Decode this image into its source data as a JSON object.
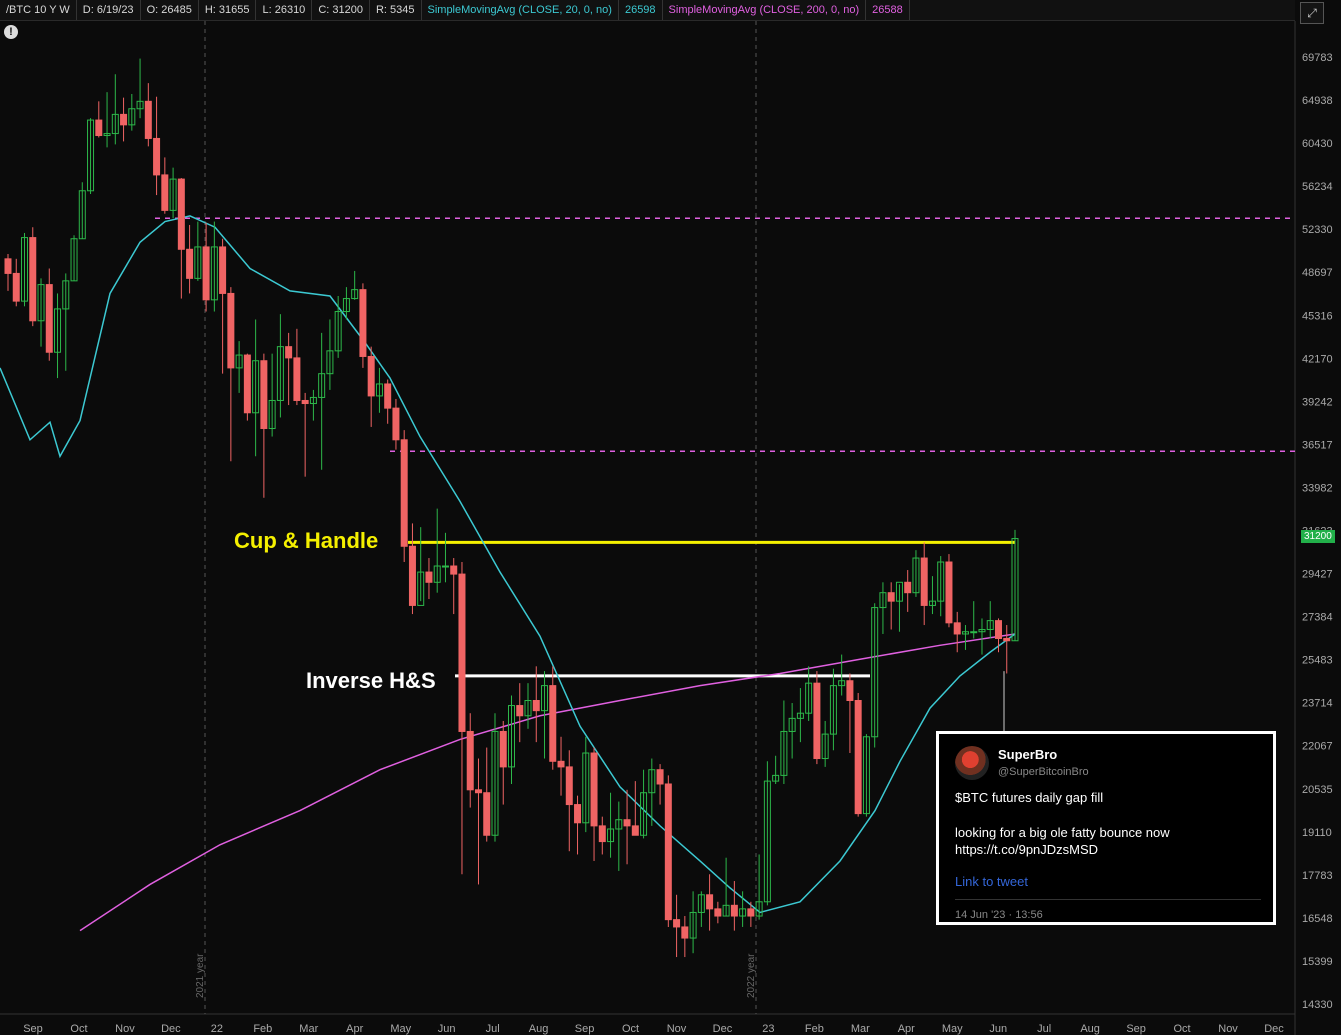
{
  "header": {
    "symbol": "/BTC 10 Y W",
    "date": "D: 6/19/23",
    "open": "O: 26485",
    "high": "H: 31655",
    "low": "L: 26310",
    "close": "C: 31200",
    "range": "R: 5345",
    "sma20_label": "SimpleMovingAvg (CLOSE, 20, 0, no)",
    "sma20_value": "26598",
    "sma200_label": "SimpleMovingAvg (CLOSE, 200, 0, no)",
    "sma200_value": "26588"
  },
  "colors": {
    "up": "#2db84a",
    "down": "#f06464",
    "sma20": "#3cc9d2",
    "sma200": "#e060e0",
    "grid_dash": "#555"
  },
  "icons": {
    "info": "info-icon",
    "expand": "expand-icon"
  },
  "info_glyph": "!",
  "annotations": {
    "cup_handle": "Cup & Handle",
    "inverse_hs": "Inverse H&S"
  },
  "price_badge": "31200",
  "tweet": {
    "name": "SuperBro",
    "handle": "@SuperBitcoinBro",
    "line1": "$BTC futures daily gap fill",
    "line2": "looking for a big ole fatty bounce now https://t.co/9pnJDzsMSD",
    "link": "Link to tweet",
    "date": "14 Jun '23 · 13:56"
  },
  "chart_data": {
    "type": "candlestick",
    "y_ticks": [
      69783,
      64938,
      60430,
      56234,
      52330,
      48697,
      45316,
      42170,
      39242,
      36517,
      33982,
      31623,
      29427,
      27384,
      25483,
      23714,
      22067,
      20535,
      19110,
      17783,
      16548,
      15399,
      14330
    ],
    "x_labels": [
      "Sep",
      "Oct",
      "Nov",
      "Dec",
      "22",
      "Feb",
      "Mar",
      "Apr",
      "May",
      "Jun",
      "Jul",
      "Aug",
      "Sep",
      "Oct",
      "Nov",
      "Dec",
      "23",
      "Feb",
      "Mar",
      "Apr",
      "May",
      "Jun",
      "Jul",
      "Aug",
      "Sep",
      "Oct",
      "Nov",
      "Dec"
    ],
    "year_labels": [
      "2021 year",
      "2022 year"
    ],
    "horizontal_levels": [
      {
        "price": 53300,
        "style": "dashed",
        "color": "#e060e0"
      },
      {
        "price": 36100,
        "style": "dashed",
        "color": "#e060e0"
      },
      {
        "price": 31000,
        "style": "solid",
        "color": "#f5f000"
      },
      {
        "price": 24800,
        "style": "solid",
        "color": "#ffffff"
      }
    ],
    "candles": [
      [
        49800,
        50200,
        47200,
        48600
      ],
      [
        48600,
        49800,
        46000,
        46400
      ],
      [
        46400,
        52000,
        46000,
        51600
      ],
      [
        51600,
        52500,
        44500,
        44900
      ],
      [
        44900,
        48200,
        43000,
        47700
      ],
      [
        47700,
        49000,
        42000,
        42600
      ],
      [
        42600,
        47000,
        40800,
        45800
      ],
      [
        45800,
        48600,
        41300,
        48000
      ],
      [
        48000,
        51800,
        48000,
        51500
      ],
      [
        51500,
        56600,
        51500,
        55800
      ],
      [
        55800,
        63000,
        55500,
        62800
      ],
      [
        62800,
        64800,
        61000,
        61200
      ],
      [
        61200,
        65800,
        60000,
        61400
      ],
      [
        61400,
        67800,
        60300,
        63400
      ],
      [
        63400,
        65200,
        60600,
        62300
      ],
      [
        62300,
        65600,
        61700,
        64000
      ],
      [
        64000,
        69600,
        63000,
        64800
      ],
      [
        64800,
        66800,
        60100,
        60900
      ],
      [
        60900,
        65300,
        55400,
        57300
      ],
      [
        57300,
        59000,
        53700,
        54000
      ],
      [
        54000,
        58000,
        53300,
        56900
      ],
      [
        56900,
        57000,
        46600,
        50600
      ],
      [
        50600,
        52700,
        47000,
        48200
      ],
      [
        48200,
        53000,
        48000,
        50800
      ],
      [
        50800,
        52900,
        45600,
        46500
      ],
      [
        46500,
        53000,
        45600,
        50800
      ],
      [
        50800,
        51500,
        41100,
        47000
      ],
      [
        47000,
        47500,
        35500,
        41500
      ],
      [
        41500,
        43400,
        39800,
        42400
      ],
      [
        42400,
        42500,
        38000,
        38500
      ],
      [
        38500,
        45000,
        35800,
        42000
      ],
      [
        42000,
        42500,
        33400,
        37500
      ],
      [
        37500,
        42500,
        37000,
        39300
      ],
      [
        39300,
        45400,
        38200,
        43000
      ],
      [
        43000,
        44000,
        39000,
        42200
      ],
      [
        42200,
        44300,
        39000,
        39300
      ],
      [
        39300,
        39800,
        34600,
        39100
      ],
      [
        39100,
        40000,
        38000,
        39500
      ],
      [
        39500,
        44000,
        35000,
        41100
      ],
      [
        41100,
        45000,
        40000,
        42700
      ],
      [
        42700,
        46800,
        42200,
        45600
      ],
      [
        45600,
        47500,
        45000,
        46600
      ],
      [
        46600,
        48800,
        46500,
        47300
      ],
      [
        47300,
        47800,
        41500,
        42300
      ],
      [
        42300,
        43000,
        37600,
        39600
      ],
      [
        39600,
        41500,
        38500,
        40400
      ],
      [
        40400,
        40700,
        37800,
        38800
      ],
      [
        38800,
        39400,
        36200,
        36800
      ],
      [
        36800,
        37400,
        30000,
        30800
      ],
      [
        30800,
        32000,
        27500,
        27900
      ],
      [
        27900,
        31800,
        28100,
        29500
      ],
      [
        29500,
        30200,
        28200,
        29000
      ],
      [
        29000,
        32800,
        28500,
        29800
      ],
      [
        29800,
        31500,
        29000,
        29800
      ],
      [
        29800,
        30200,
        27500,
        29400
      ],
      [
        29400,
        30000,
        17800,
        22600
      ],
      [
        22600,
        23300,
        19900,
        20500
      ],
      [
        20500,
        21600,
        17500,
        20400
      ],
      [
        20400,
        22000,
        18800,
        19000
      ],
      [
        19000,
        23300,
        18800,
        22600
      ],
      [
        22600,
        23000,
        20000,
        21300
      ],
      [
        21300,
        24000,
        20700,
        23600
      ],
      [
        23600,
        24500,
        22200,
        23200
      ],
      [
        23200,
        24500,
        22700,
        23800
      ],
      [
        23800,
        25200,
        22200,
        23400
      ],
      [
        23400,
        25000,
        21600,
        24400
      ],
      [
        24400,
        25200,
        21200,
        21500
      ],
      [
        21500,
        22400,
        20300,
        21300
      ],
      [
        21300,
        21900,
        18500,
        20000
      ],
      [
        20000,
        20300,
        18400,
        19400
      ],
      [
        19400,
        22400,
        19100,
        21800
      ],
      [
        21800,
        22000,
        18200,
        19300
      ],
      [
        19300,
        19600,
        18400,
        18800
      ],
      [
        18800,
        20400,
        18300,
        19200
      ],
      [
        19200,
        20100,
        17900,
        19500
      ],
      [
        19500,
        20500,
        18100,
        19300
      ],
      [
        19300,
        20800,
        19000,
        19000
      ],
      [
        19000,
        21200,
        18900,
        20400
      ],
      [
        20400,
        21600,
        19300,
        21200
      ],
      [
        21200,
        21400,
        20000,
        20700
      ],
      [
        20700,
        21000,
        16300,
        16500
      ],
      [
        16500,
        17200,
        15500,
        16300
      ],
      [
        16300,
        16600,
        15500,
        16000
      ],
      [
        16000,
        17300,
        15600,
        16700
      ],
      [
        16700,
        17300,
        16300,
        17200
      ],
      [
        17200,
        17800,
        16200,
        16800
      ],
      [
        16800,
        17000,
        16400,
        16600
      ],
      [
        16600,
        18300,
        16600,
        16900
      ],
      [
        16900,
        17600,
        16200,
        16600
      ],
      [
        16600,
        17300,
        16300,
        16800
      ],
      [
        16800,
        17000,
        16300,
        16600
      ],
      [
        16600,
        18400,
        16500,
        17000
      ],
      [
        17000,
        21500,
        16900,
        20800
      ],
      [
        20800,
        21700,
        20700,
        21000
      ],
      [
        21000,
        23800,
        20700,
        22600
      ],
      [
        22600,
        23700,
        21600,
        23100
      ],
      [
        23100,
        24300,
        22200,
        23300
      ],
      [
        23300,
        25200,
        23000,
        24500
      ],
      [
        24500,
        25000,
        21400,
        21600
      ],
      [
        21600,
        23000,
        21300,
        22500
      ],
      [
        22500,
        25100,
        21900,
        24400
      ],
      [
        24400,
        25700,
        24000,
        24600
      ],
      [
        24600,
        24900,
        21800,
        23800
      ],
      [
        23800,
        24100,
        19600,
        19700
      ],
      [
        19700,
        22500,
        19600,
        22400
      ],
      [
        22400,
        28000,
        22000,
        27800
      ],
      [
        27800,
        29000,
        26600,
        28500
      ],
      [
        28500,
        29000,
        26800,
        28100
      ],
      [
        28100,
        28900,
        26700,
        29000
      ],
      [
        29000,
        29600,
        27600,
        28500
      ],
      [
        28500,
        30600,
        28300,
        30200
      ],
      [
        30200,
        31000,
        27000,
        27900
      ],
      [
        27900,
        29300,
        27500,
        28100
      ],
      [
        28100,
        30300,
        27400,
        30000
      ],
      [
        30000,
        30400,
        26900,
        27100
      ],
      [
        27100,
        27600,
        25800,
        26600
      ],
      [
        26600,
        27000,
        25900,
        26700
      ],
      [
        26700,
        28100,
        26400,
        26700
      ],
      [
        26700,
        27300,
        25700,
        26800
      ],
      [
        26800,
        28100,
        26400,
        27200
      ],
      [
        27200,
        27300,
        25800,
        26400
      ],
      [
        26400,
        27000,
        24900,
        26300
      ],
      [
        26300,
        31655,
        26300,
        31200
      ]
    ],
    "sma20": [
      [
        0,
        41500
      ],
      [
        30,
        36800
      ],
      [
        50,
        37900
      ],
      [
        60,
        35800
      ],
      [
        80,
        38000
      ],
      [
        110,
        47000
      ],
      [
        140,
        51200
      ],
      [
        165,
        53000
      ],
      [
        190,
        53500
      ],
      [
        215,
        52500
      ],
      [
        250,
        49000
      ],
      [
        290,
        47200
      ],
      [
        330,
        46800
      ],
      [
        365,
        43300
      ],
      [
        390,
        40800
      ],
      [
        420,
        37000
      ],
      [
        460,
        33200
      ],
      [
        500,
        29500
      ],
      [
        540,
        26500
      ],
      [
        580,
        22800
      ],
      [
        620,
        20600
      ],
      [
        660,
        19300
      ],
      [
        700,
        18200
      ],
      [
        730,
        17400
      ],
      [
        760,
        16700
      ],
      [
        800,
        17000
      ],
      [
        840,
        18200
      ],
      [
        875,
        19800
      ],
      [
        900,
        21500
      ],
      [
        930,
        23500
      ],
      [
        960,
        24800
      ],
      [
        990,
        25800
      ],
      [
        1015,
        26600
      ]
    ],
    "sma200": [
      [
        80,
        16200
      ],
      [
        150,
        17500
      ],
      [
        220,
        18700
      ],
      [
        300,
        19800
      ],
      [
        380,
        21200
      ],
      [
        460,
        22300
      ],
      [
        540,
        23200
      ],
      [
        620,
        23800
      ],
      [
        700,
        24400
      ],
      [
        780,
        24900
      ],
      [
        860,
        25500
      ],
      [
        940,
        26100
      ],
      [
        1015,
        26600
      ]
    ]
  }
}
